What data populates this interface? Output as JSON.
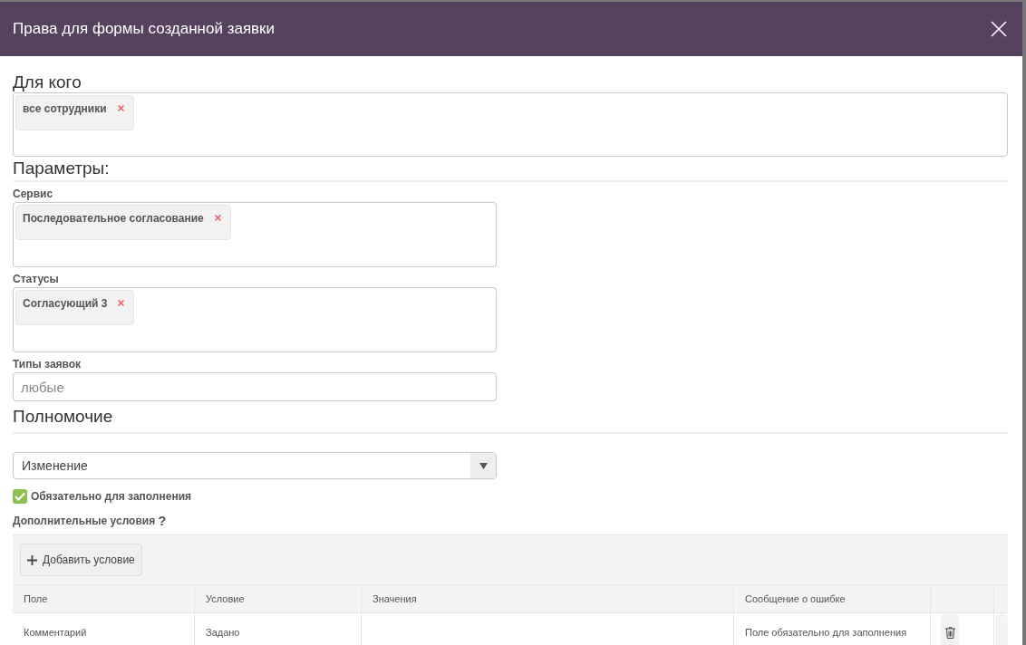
{
  "dialog": {
    "title": "Права для формы созданной заявки"
  },
  "for_whom": {
    "heading": "Для кого",
    "tags": [
      {
        "label": "все сотрудники"
      }
    ]
  },
  "parameters": {
    "heading": "Параметры:",
    "fields": [
      {
        "kind": "tags",
        "label": "Сервис",
        "tags": [
          {
            "label": "Последовательное согласование"
          }
        ]
      },
      {
        "kind": "tags",
        "label": "Статусы",
        "tags": [
          {
            "label": "Согласующий 3"
          }
        ]
      },
      {
        "kind": "input",
        "label": "Типы заявок",
        "placeholder": "любые"
      }
    ]
  },
  "authority": {
    "heading": "Полномочие",
    "select_value": "Изменение",
    "required": {
      "label": "Обязательно для заполнения",
      "checked": true
    }
  },
  "conditions": {
    "label": "Дополнительные условия",
    "help": "?",
    "add_button": "Добавить условие",
    "table": {
      "columns": [
        "Поле",
        "Условие",
        "Значения",
        "Сообщение о ошибке"
      ],
      "rows": [
        {
          "cells": [
            "Комментарий",
            "Задано",
            "",
            "Поле обязательно для заполнения"
          ]
        }
      ]
    }
  }
}
